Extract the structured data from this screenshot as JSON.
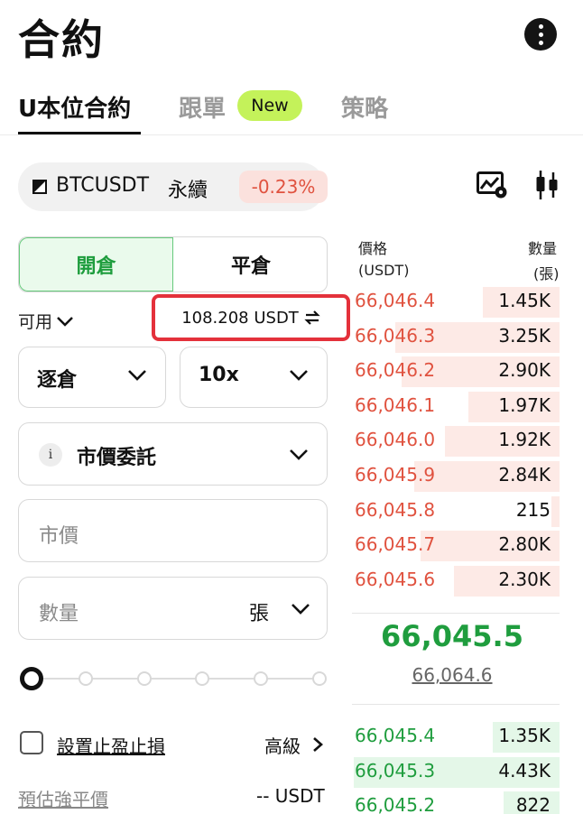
{
  "header": {
    "title": "合約"
  },
  "tabs": [
    {
      "label": "U本位合約",
      "active": true
    },
    {
      "label": "跟單",
      "badge": "New"
    },
    {
      "label": "策略"
    }
  ],
  "symbol": {
    "name": "BTCUSDT",
    "type": "永續",
    "change": "-0.23%"
  },
  "order_side": {
    "open_label": "開倉",
    "close_label": "平倉"
  },
  "available": {
    "label": "可用",
    "value": "108.208 USDT"
  },
  "margin_mode": {
    "label": "逐倉"
  },
  "leverage": {
    "label": "10x"
  },
  "order_type": {
    "info": "i",
    "label": "市價委託"
  },
  "price_input": {
    "placeholder": "市價"
  },
  "qty_input": {
    "placeholder": "數量",
    "unit": "張"
  },
  "slider": {
    "percent": 0
  },
  "tpsl": {
    "label": "設置止盈止損",
    "checked": false
  },
  "advanced": {
    "label": "高級"
  },
  "liquidation": {
    "label": "預估強平價",
    "value": "-- USDT"
  },
  "orderbook": {
    "price_header": "價格",
    "price_unit": "(USDT)",
    "qty_header": "數量",
    "qty_unit": "(張)",
    "asks": [
      {
        "price": "66,046.4",
        "qty": "1.45K",
        "depth": 0.37
      },
      {
        "price": "66,046.3",
        "qty": "3.25K",
        "depth": 0.79
      },
      {
        "price": "66,046.2",
        "qty": "2.90K",
        "depth": 0.76
      },
      {
        "price": "66,046.1",
        "qty": "1.97K",
        "depth": 0.44
      },
      {
        "price": "66,046.0",
        "qty": "1.92K",
        "depth": 0.55
      },
      {
        "price": "66,045.9",
        "qty": "2.84K",
        "depth": 0.7
      },
      {
        "price": "66,045.8",
        "qty": "215",
        "depth": 0.04
      },
      {
        "price": "66,045.7",
        "qty": "2.80K",
        "depth": 0.67
      },
      {
        "price": "66,045.6",
        "qty": "2.30K",
        "depth": 0.51
      }
    ],
    "last_price": "66,045.5",
    "mark_price": "66,064.6",
    "bids": [
      {
        "price": "66,045.4",
        "qty": "1.35K",
        "depth": 0.32
      },
      {
        "price": "66,045.3",
        "qty": "4.43K",
        "depth": 0.99
      },
      {
        "price": "66,045.2",
        "qty": "822",
        "depth": 0.27
      }
    ]
  }
}
